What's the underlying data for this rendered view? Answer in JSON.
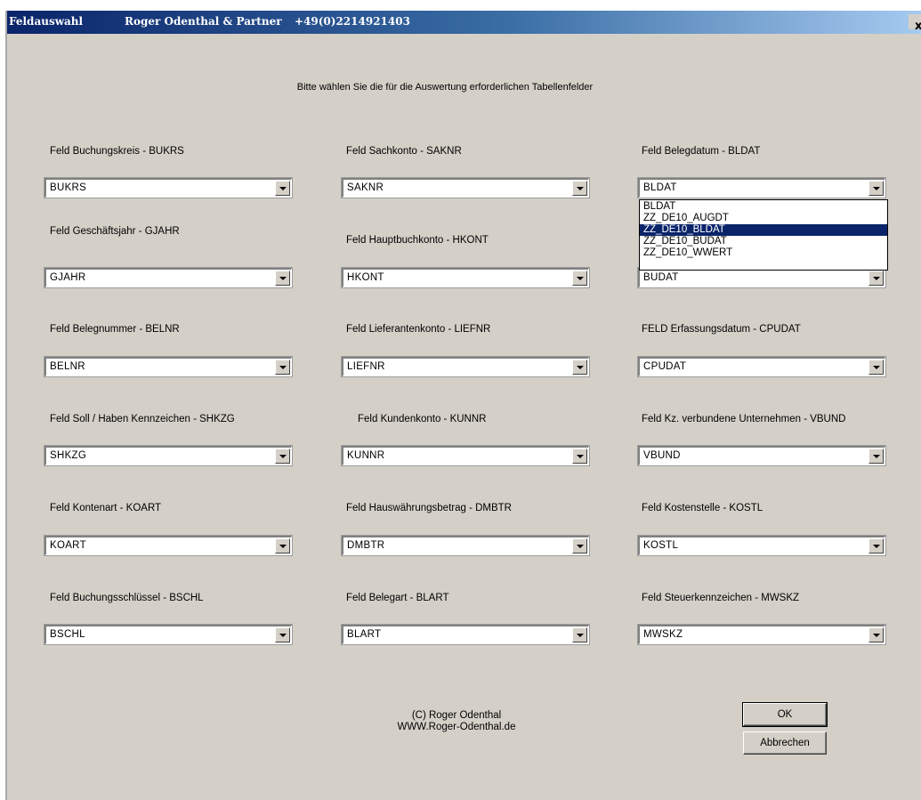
{
  "title": {
    "app": "Feldauswahl",
    "company": "Roger Odenthal & Partner",
    "phone": "+49(0)2214921403",
    "close_glyph": "x"
  },
  "instruction": "Bitte wählen Sie die für die Auswertung erforderlichen Tabellenfelder",
  "fields": [
    {
      "label": "Feld Buchungskreis - BUKRS",
      "value": "BUKRS"
    },
    {
      "label": "Feld Sachkonto - SAKNR",
      "value": "SAKNR"
    },
    {
      "label": "Feld Belegdatum - BLDAT",
      "value": "BLDAT"
    },
    {
      "label": "Feld Geschäftsjahr - GJAHR",
      "value": "GJAHR"
    },
    {
      "label": "Feld Hauptbuchkonto - HKONT",
      "value": "HKONT"
    },
    {
      "label": "",
      "value": "BUDAT"
    },
    {
      "label": "Feld Belegnummer - BELNR",
      "value": "BELNR"
    },
    {
      "label": "Feld Lieferantenkonto - LIEFNR",
      "value": "LIEFNR"
    },
    {
      "label": "FELD Erfassungsdatum - CPUDAT",
      "value": "CPUDAT"
    },
    {
      "label": "Feld Soll / Haben Kennzeichen - SHKZG",
      "value": "SHKZG"
    },
    {
      "label": "Feld Kundenkonto - KUNNR",
      "value": "KUNNR"
    },
    {
      "label": "Feld  Kz. verbundene Unternehmen - VBUND",
      "value": "VBUND"
    },
    {
      "label": "Feld Kontenart - KOART",
      "value": "KOART"
    },
    {
      "label": "Feld Hauswährungsbetrag - DMBTR",
      "value": "DMBTR"
    },
    {
      "label": "Feld Kostenstelle - KOSTL",
      "value": "KOSTL"
    },
    {
      "label": "Feld Buchungsschlüssel - BSCHL",
      "value": "BSCHL"
    },
    {
      "label": "Feld Belegart - BLART",
      "value": "BLART"
    },
    {
      "label": "Feld Steuerkennzeichen - MWSKZ",
      "value": "MWSKZ"
    }
  ],
  "open_dropdown": {
    "options": [
      "BLDAT",
      "ZZ_DE10_AUGDT",
      "ZZ_DE10_BLDAT",
      "ZZ_DE10_BUDAT",
      "ZZ_DE10_WWERT"
    ],
    "highlighted": "ZZ_DE10_BLDAT"
  },
  "footer": {
    "copyright_line1": "(C) Roger Odenthal",
    "copyright_line2": "WWW.Roger-Odenthal.de"
  },
  "buttons": {
    "ok": "OK",
    "cancel": "Abbrechen"
  },
  "colors": {
    "titlebar_start": "#0a246a",
    "titlebar_end": "#a6caf0",
    "window_bg": "#d4d0c8",
    "selection": "#0a246a"
  }
}
